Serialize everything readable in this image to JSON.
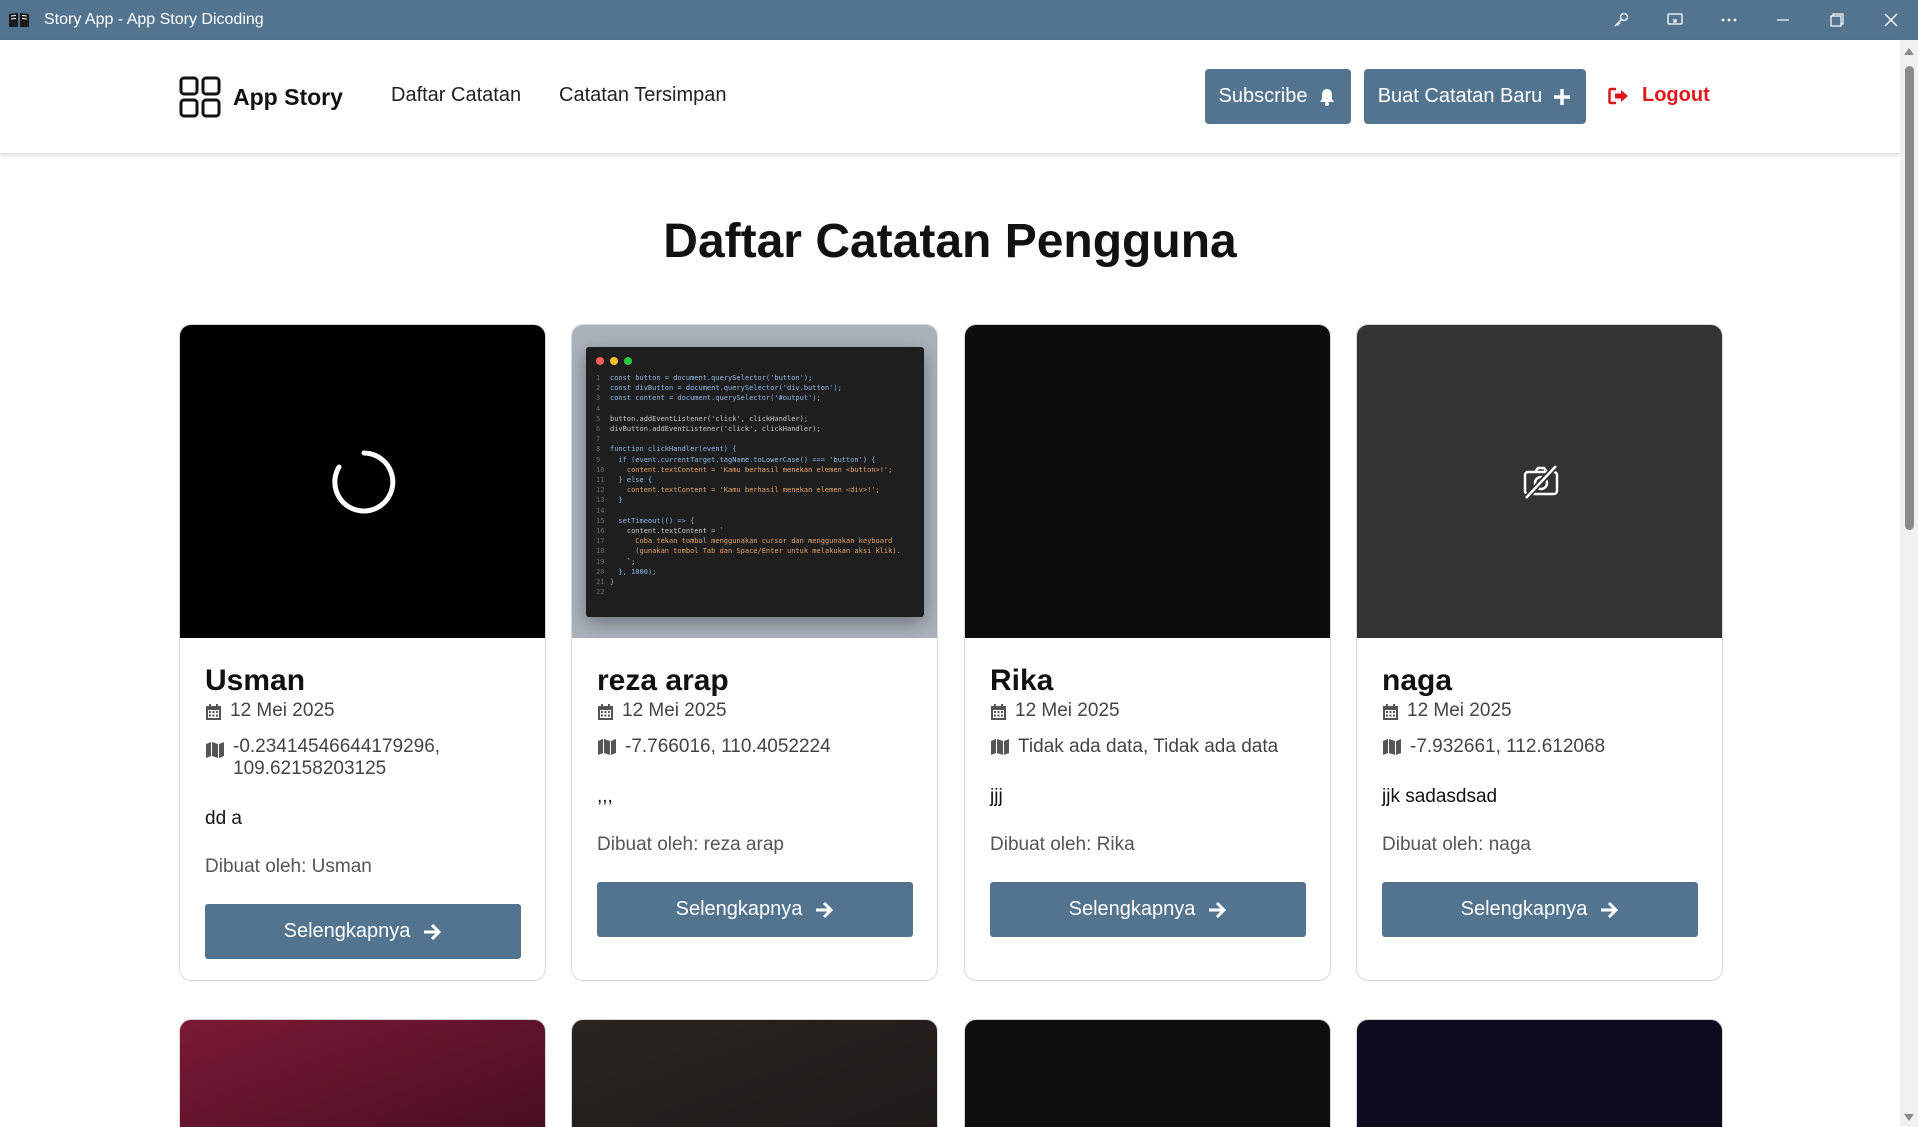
{
  "window": {
    "title": "Story App - App Story Dicoding",
    "colors": {
      "titlebar": "#52748f"
    }
  },
  "header": {
    "brand": "App Story",
    "nav": [
      "Daftar Catatan",
      "Catatan Tersimpan"
    ],
    "subscribe_label": "Subscribe",
    "new_story_label": "Buat Catatan Baru",
    "logout_label": "Logout",
    "colors": {
      "primary": "#52748f",
      "logout": "#e0181b"
    }
  },
  "page": {
    "title": "Daftar Catatan Pengguna"
  },
  "cards": [
    {
      "name": "Usman",
      "date": "12 Mei 2025",
      "location_line1": "-0.23414546644179296,",
      "location_line2": "109.62158203125",
      "description": "dd a",
      "author": "Dibuat oleh: Usman",
      "button": "Selengkapnya",
      "media": "loading-spinner"
    },
    {
      "name": "reza arap",
      "date": "12 Mei 2025",
      "location": "-7.766016, 110.4052224",
      "description": ",,,",
      "author": "Dibuat oleh: reza arap",
      "button": "Selengkapnya",
      "media": "code-screenshot"
    },
    {
      "name": "Rika",
      "date": "12 Mei 2025",
      "location": "Tidak ada data, Tidak ada data",
      "description": "jjj",
      "author": "Dibuat oleh: Rika",
      "button": "Selengkapnya",
      "media": "dark-photo"
    },
    {
      "name": "naga",
      "date": "12 Mei 2025",
      "location": "-7.932661, 112.612068",
      "description": "jjk sadasdsad",
      "author": "Dibuat oleh: naga",
      "button": "Selengkapnya",
      "media": "image-unavailable-icon"
    }
  ],
  "code_lines": [
    "const button = document.querySelector('button');",
    "const divButton = document.querySelector('div.button');",
    "const content = document.querySelector('#output');",
    "",
    "button.addEventListener('click', clickHandler);",
    "divButton.addEventListener('click', clickHandler);",
    "",
    "function clickHandler(event) {",
    "  if (event.currentTarget.tagName.toLowerCase() === 'button') {",
    "    content.textContent = 'Kamu berhasil menekan elemen <button>!';",
    "  } else {",
    "    content.textContent = 'Kamu berhasil menekan elemen <div>!';",
    "  }",
    "",
    "  setTimeout(() => {",
    "    content.textContent = `",
    "      Coba tekan tombol menggunakan cursor dan menggunakan keyboard",
    "      (gunakan tombol Tab dan Space/Enter untuk melakukan aksi klik).",
    "    `;",
    "  }, 1000);",
    "}",
    ""
  ]
}
